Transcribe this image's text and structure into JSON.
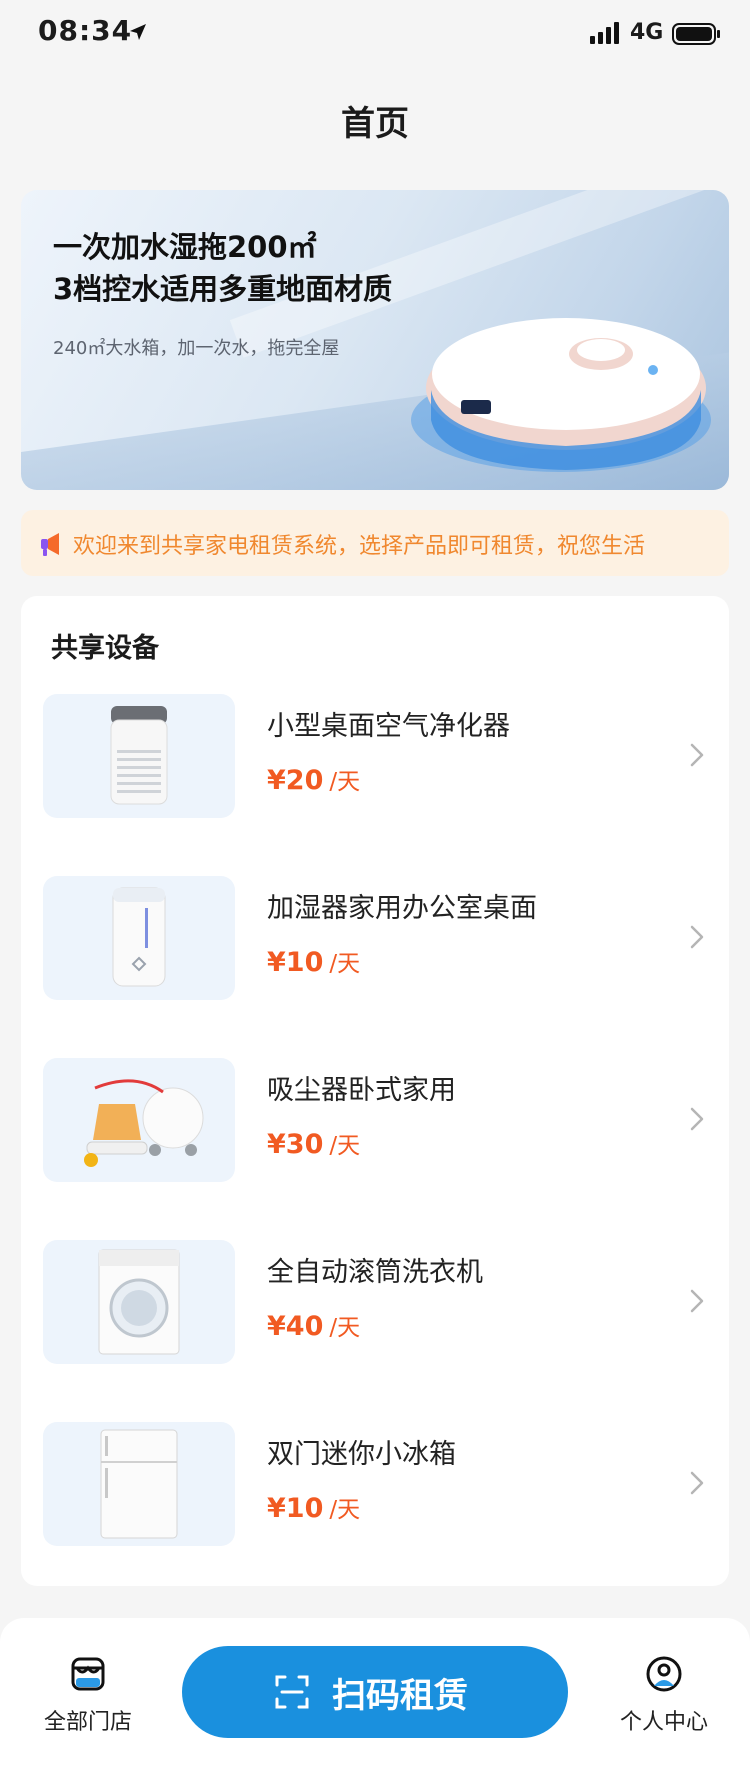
{
  "status_bar": {
    "time": "08:34",
    "network": "4G",
    "icons": [
      "location-arrow-icon",
      "signal-icon",
      "battery-icon"
    ]
  },
  "nav": {
    "title": "首页"
  },
  "banner": {
    "headline_line1": "一次加水湿拖200㎡",
    "headline_line2": "3档控水适用多重地面材质",
    "subtitle": "240㎡大水箱，加一次水，拖完全屋"
  },
  "notice": {
    "text": "欢迎来到共享家电租赁系统，选择产品即可租赁，祝您生活",
    "color": "#f0882f",
    "icon": "speaker-icon"
  },
  "devices": {
    "title": "共享设备",
    "items": [
      {
        "name": "小型桌面空气净化器",
        "price": "¥20",
        "unit": "/天",
        "icon": "air-purifier-icon"
      },
      {
        "name": "加湿器家用办公室桌面",
        "price": "¥10",
        "unit": "/天",
        "icon": "humidifier-icon"
      },
      {
        "name": "吸尘器卧式家用",
        "price": "¥30",
        "unit": "/天",
        "icon": "vacuum-cleaner-icon"
      },
      {
        "name": "全自动滚筒洗衣机",
        "price": "¥40",
        "unit": "/天",
        "icon": "washing-machine-icon"
      },
      {
        "name": "双门迷你小冰箱",
        "price": "¥10",
        "unit": "/天",
        "icon": "fridge-icon"
      }
    ]
  },
  "tabbar": {
    "stores_label": "全部门店",
    "scan_label": "扫码租赁",
    "profile_label": "个人中心"
  },
  "colors": {
    "accent": "#1a90de",
    "price": "#f15a22",
    "notice_bg": "#fdf1e2"
  }
}
